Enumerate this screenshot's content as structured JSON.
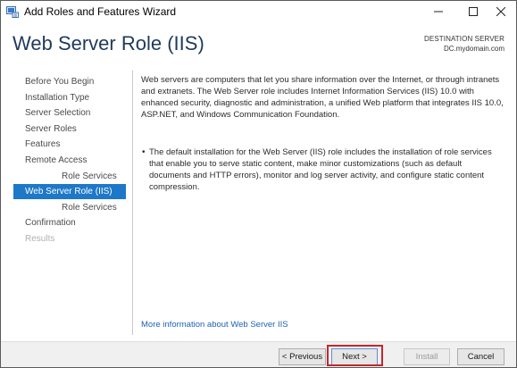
{
  "window": {
    "title": "Add Roles and Features Wizard"
  },
  "header": {
    "page_title": "Web Server Role (IIS)",
    "destination_label": "DESTINATION SERVER",
    "destination_value": "DC.mydomain.com"
  },
  "nav": {
    "items": [
      {
        "label": "Before You Begin",
        "state": "normal"
      },
      {
        "label": "Installation Type",
        "state": "normal"
      },
      {
        "label": "Server Selection",
        "state": "normal"
      },
      {
        "label": "Server Roles",
        "state": "normal"
      },
      {
        "label": "Features",
        "state": "normal"
      },
      {
        "label": "Remote Access",
        "state": "normal"
      },
      {
        "label": "Role Services",
        "state": "normal",
        "sub": true
      },
      {
        "label": "Web Server Role (IIS)",
        "state": "active"
      },
      {
        "label": "Role Services",
        "state": "normal",
        "sub": true
      },
      {
        "label": "Confirmation",
        "state": "normal"
      },
      {
        "label": "Results",
        "state": "disabled"
      }
    ]
  },
  "content": {
    "intro": "Web servers are computers that let you share information over the Internet, or through intranets and extranets. The Web Server role includes Internet Information Services (IIS) 10.0 with enhanced security, diagnostic and administration, a unified Web platform that integrates IIS 10.0, ASP.NET, and Windows Communication Foundation.",
    "bullet": "The default installation for the Web Server (IIS) role includes the installation of role services that enable you to serve static content, make minor customizations (such as default documents and HTTP errors), monitor and log server activity, and configure static content compression.",
    "more_link": "More information about Web Server IIS"
  },
  "footer": {
    "previous_label": "< Previous",
    "next_label": "Next >",
    "install_label": "Install",
    "cancel_label": "Cancel"
  },
  "colors": {
    "accent": "#1e78c8",
    "title": "#1f3a5b",
    "link": "#1e62b4",
    "highlight": "#c0282d"
  }
}
